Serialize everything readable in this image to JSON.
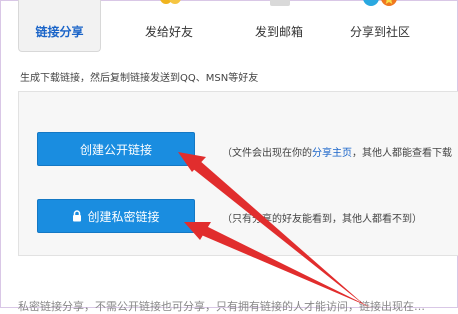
{
  "tabs": [
    {
      "label": "链接分享",
      "active": true
    },
    {
      "label": "发给好友",
      "icon": "friends-icon"
    },
    {
      "label": "发到邮箱",
      "icon": "mail-icon"
    },
    {
      "label": "分享到社区",
      "icon": "community-icon"
    }
  ],
  "intro_text": "生成下载链接，然后复制链接发送到QQ、MSN等好友",
  "public_link": {
    "button_label": "创建公开链接",
    "desc_before": "（文件会出现在你的",
    "desc_link": "分享主页",
    "desc_after": "，其他人都能查看下载"
  },
  "private_link": {
    "button_label": "创建私密链接",
    "icon": "lock-icon",
    "desc": "（只有分享的好友能看到，其他人都看不到）"
  },
  "bottom_text": "私密链接分享，不需公开链接也可分享，只有拥有链接的人才能访问，链接出现在…",
  "colors": {
    "accent": "#1a8de0",
    "link": "#1a64c8",
    "arrow": "#e12d2d"
  }
}
